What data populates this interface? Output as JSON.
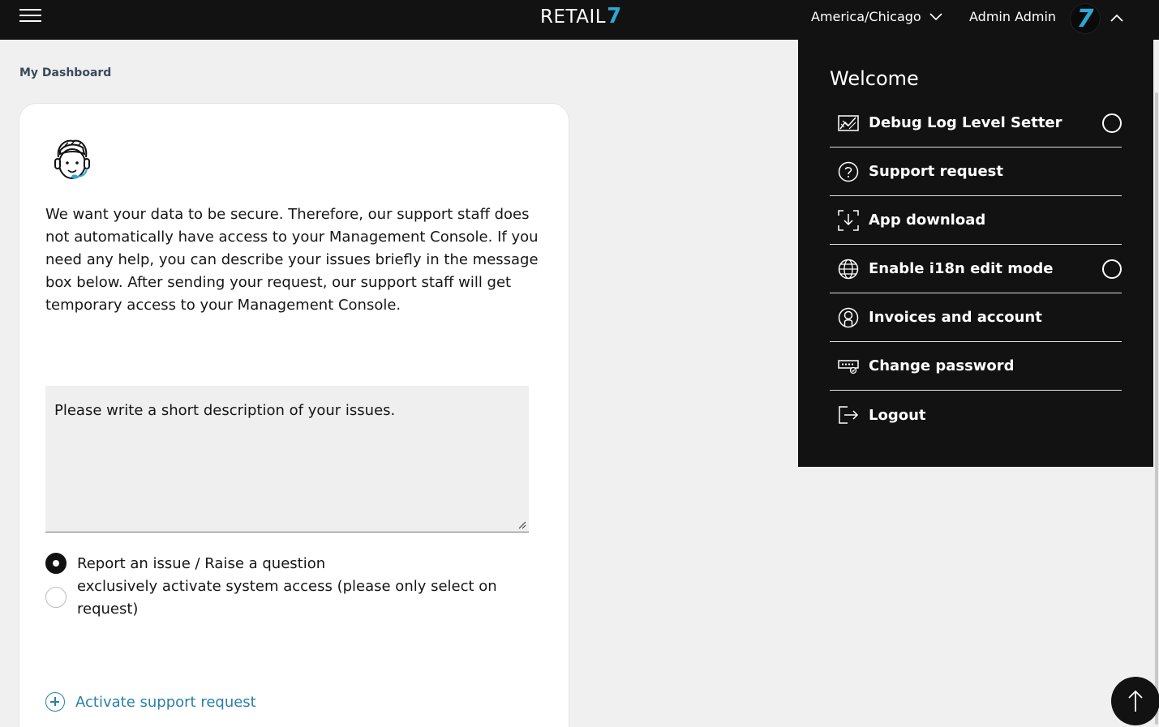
{
  "header": {
    "logo_text": "RETAIL",
    "logo_mark": "7",
    "timezone": "America/Chicago",
    "user_name": "Admin Admin",
    "avatar_text": "7"
  },
  "breadcrumb": "My Dashboard",
  "card": {
    "intro": "We want your data to be secure. Therefore, our support staff does not automatically have access to your Management Console. If you need any help, you can describe your issues briefly in the message box below. After sending your request, our support staff will get temporary access to your Management Console.",
    "textarea_placeholder": "Please write a short description of your issues.",
    "radio_options": [
      {
        "label": "Report an issue / Raise a question",
        "checked": true
      },
      {
        "label": "exclusively activate system access (please only select on request)",
        "checked": false
      }
    ],
    "activate_label": "Activate support request"
  },
  "panel": {
    "title": "Welcome",
    "items": [
      {
        "label": "Debug Log Level Setter",
        "icon": "chart-icon",
        "toggle": true
      },
      {
        "label": "Support request",
        "icon": "question-icon",
        "toggle": false
      },
      {
        "label": "App download",
        "icon": "download-icon",
        "toggle": false
      },
      {
        "label": "Enable i18n edit mode",
        "icon": "globe-icon",
        "toggle": true
      },
      {
        "label": "Invoices and account",
        "icon": "account-icon",
        "toggle": false
      },
      {
        "label": "Change password",
        "icon": "password-icon",
        "toggle": false
      },
      {
        "label": "Logout",
        "icon": "logout-icon",
        "toggle": false
      }
    ]
  },
  "colors": {
    "topbar": "#121212",
    "accent": "#2aa9d6",
    "link": "#2a7fa8"
  }
}
